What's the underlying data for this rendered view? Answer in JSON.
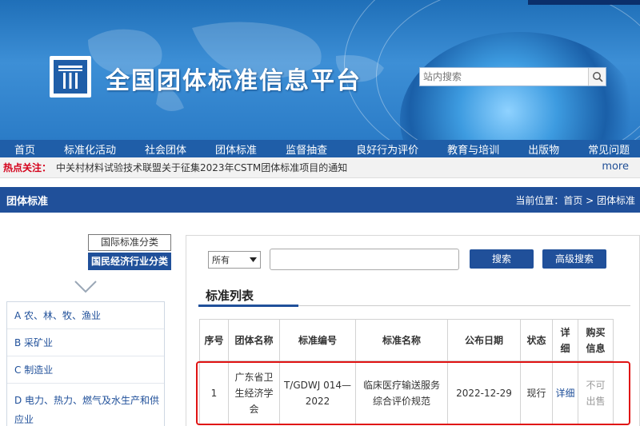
{
  "header": {
    "site_title": "全国团体标准信息平台",
    "search_placeholder": "站内搜索",
    "colors": {
      "banner": "#2b7cc7",
      "nav": "#1f5ea8",
      "accent": "#20509a",
      "hot": "#d4001a",
      "highlight": "#e01313"
    }
  },
  "nav": {
    "items": [
      "首页",
      "标准化活动",
      "社会团体",
      "团体标准",
      "监督抽查",
      "良好行为评价",
      "教育与培训",
      "出版物",
      "常见问题"
    ]
  },
  "hot": {
    "label": "热点关注：",
    "text": "中关村材料试验技术联盟关于征集2023年CSTM团体标准项目的通知",
    "more": "more"
  },
  "section": {
    "title": "团体标准",
    "breadcrumb": "当前位置：首页 > 团体标准"
  },
  "categories": {
    "tab_international": "国际标准分类",
    "tab_economy": "国民经济行业分类",
    "items": [
      "A 农、林、牧、渔业",
      "B 采矿业",
      "C 制造业",
      "D 电力、热力、燃气及水生产和供应业"
    ]
  },
  "filter": {
    "select_value": "所有",
    "search_button": "搜索",
    "advanced_button": "高级搜索"
  },
  "list": {
    "title": "标准列表",
    "headers": [
      "序号",
      "团体名称",
      "标准编号",
      "标准名称",
      "公布日期",
      "状态",
      "详细",
      "购买信息"
    ],
    "rows": [
      {
        "no": "1",
        "org": "广东省卫生经济学会",
        "code": "T/GDWJ 014—2022",
        "name": "临床医疗输送服务综合评价规范",
        "date": "2022-12-29",
        "status": "现行",
        "detail": "详细",
        "buy": "不可出售"
      }
    ]
  }
}
